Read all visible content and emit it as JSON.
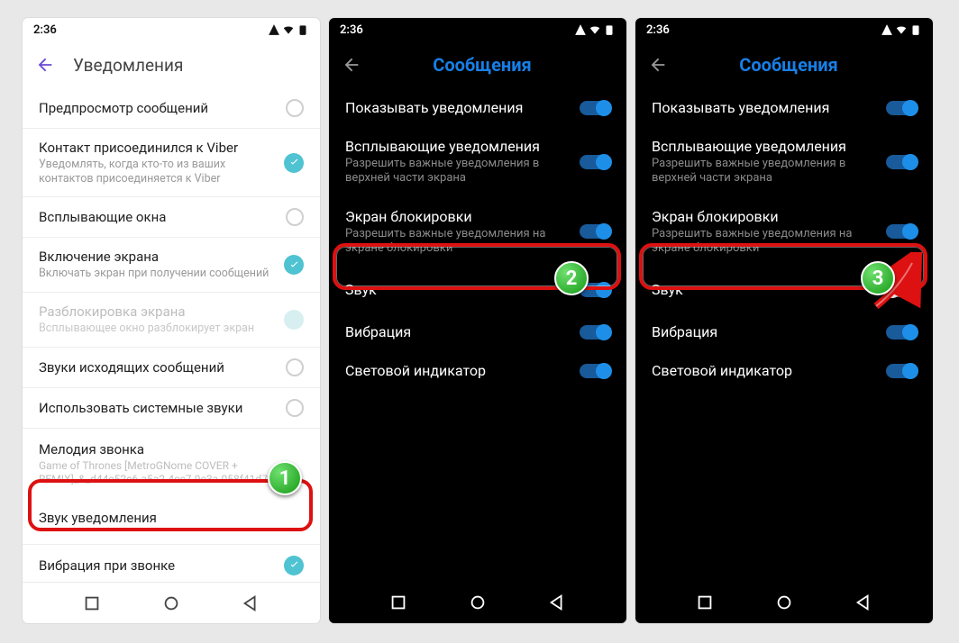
{
  "statusbar": {
    "time": "2:36"
  },
  "light": {
    "header_title": "Уведомления",
    "rows": {
      "preview": "Предпросмотр сообщений",
      "contact_joined_title": "Контакт присоединился к Viber",
      "contact_joined_sub": "Уведомлять, когда кто-то из ваших контактов присоединяется к Viber",
      "popup": "Всплывающие окна",
      "screen_on_title": "Включение экрана",
      "screen_on_sub": "Включать экран при получении сообщений",
      "unlock_title": "Разблокировка экрана",
      "unlock_sub": "Всплывающее окно разблокирует экран",
      "outgoing": "Звуки исходящих сообщений",
      "system_sounds": "Использовать системные звуки",
      "ringtone_title": "Мелодия звонка",
      "ringtone_sub": "Game of Thrones [MetroGNome COVER + REMIX]_&_d44e52c6-a5a2-4ec7-9e3a-058f41d71d2",
      "notif_sound": "Звук уведомления",
      "vibrate_call": "Вибрация при звонке"
    }
  },
  "dark": {
    "header_title": "Сообщения",
    "row_show": "Показывать уведомления",
    "row_popup_title": "Всплывающие уведомления",
    "row_popup_sub": "Разрешить важные уведомления в верхней части экрана",
    "row_lock_title": "Экран блокировки",
    "row_lock_sub": "Разрешить важные уведомления на экране блокировки",
    "row_sound": "Звук",
    "row_vibrate": "Вибрация",
    "row_light": "Световой индикатор"
  },
  "badges": {
    "b1": "1",
    "b2": "2",
    "b3": "3"
  }
}
